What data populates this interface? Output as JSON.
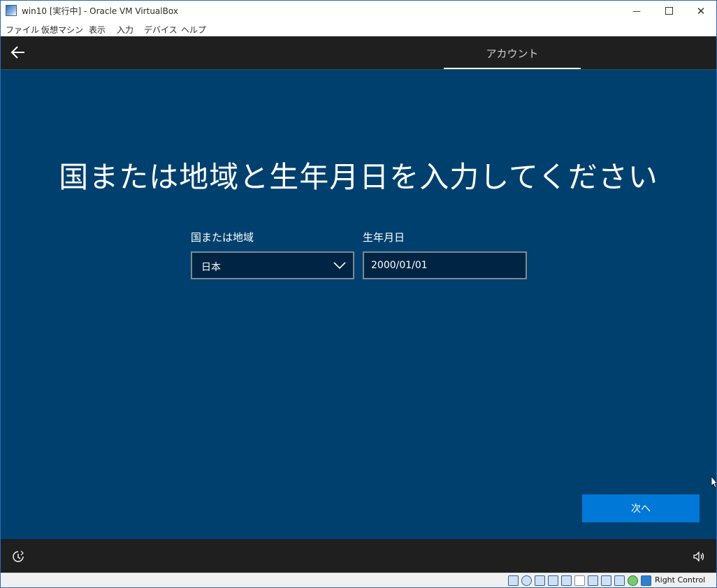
{
  "window": {
    "title": "win10 [実行中] - Oracle VM VirtualBox",
    "min_glyph": "—",
    "close_glyph": "✕"
  },
  "menu": {
    "items": [
      "ファイル",
      "仮想マシン",
      "表示",
      "入力",
      "デバイス",
      "ヘルプ"
    ]
  },
  "oobe": {
    "step_label": "アカウント",
    "heading": "国または地域と生年月日を入力してください",
    "region": {
      "label": "国または地域",
      "value": "日本"
    },
    "dob": {
      "label": "生年月日",
      "value": "2000/01/01"
    },
    "next_label": "次へ"
  },
  "statusbar": {
    "host_key": "Right Control"
  },
  "colors": {
    "oobe_background": "#00406e",
    "accent_button": "#0078d7",
    "dark_bar": "#1f1f1f"
  },
  "icons": {
    "back": "back-arrow-icon",
    "dropdown": "chevron-down-icon",
    "ease_of_access": "ease-of-access-icon",
    "volume": "volume-icon"
  }
}
